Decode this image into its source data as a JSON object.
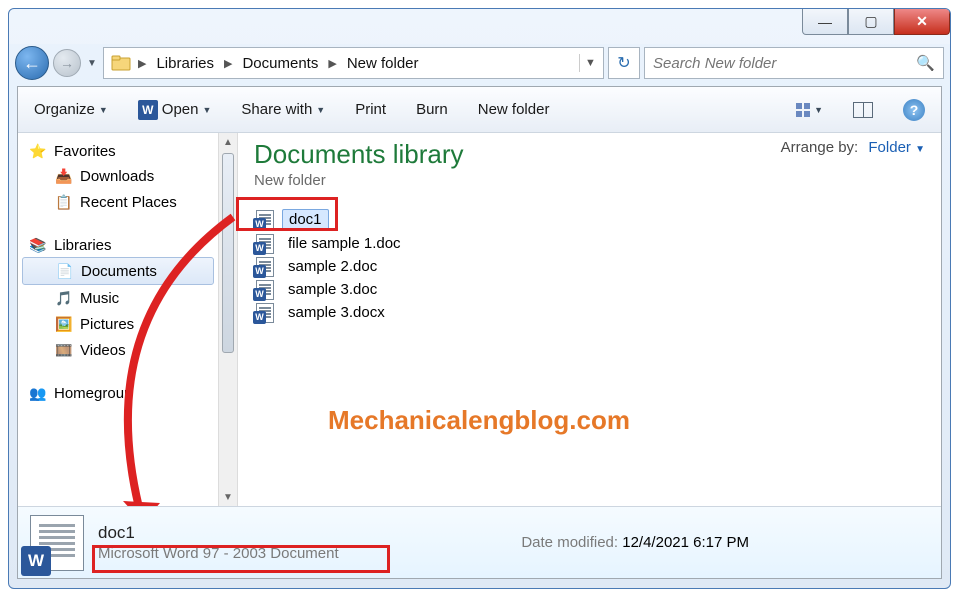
{
  "window_controls": {
    "minimize": "—",
    "maximize": "▢",
    "close": "✕"
  },
  "breadcrumb": {
    "seg1": "Libraries",
    "seg2": "Documents",
    "seg3": "New folder"
  },
  "search": {
    "placeholder": "Search New folder"
  },
  "toolbar": {
    "organize": "Organize",
    "open": "Open",
    "share": "Share with",
    "print": "Print",
    "burn": "Burn",
    "newfolder": "New folder"
  },
  "nav": {
    "favorites": "Favorites",
    "downloads": "Downloads",
    "recent": "Recent Places",
    "libraries": "Libraries",
    "documents": "Documents",
    "music": "Music",
    "pictures": "Pictures",
    "videos": "Videos",
    "homegroup": "Homegroup"
  },
  "library": {
    "title": "Documents library",
    "subtitle": "New folder",
    "arrange_label": "Arrange by:",
    "arrange_value": "Folder"
  },
  "files": [
    {
      "name": "doc1",
      "selected": true
    },
    {
      "name": "file sample 1.doc",
      "selected": false
    },
    {
      "name": "sample 2.doc",
      "selected": false
    },
    {
      "name": "sample 3.doc",
      "selected": false
    },
    {
      "name": "sample 3.docx",
      "selected": false
    }
  ],
  "watermark": "Mechanicalengblog.com",
  "details": {
    "name": "doc1",
    "type": "Microsoft Word 97 - 2003 Document",
    "date_label": "Date modified:",
    "date_value": "12/4/2021 6:17 PM"
  }
}
